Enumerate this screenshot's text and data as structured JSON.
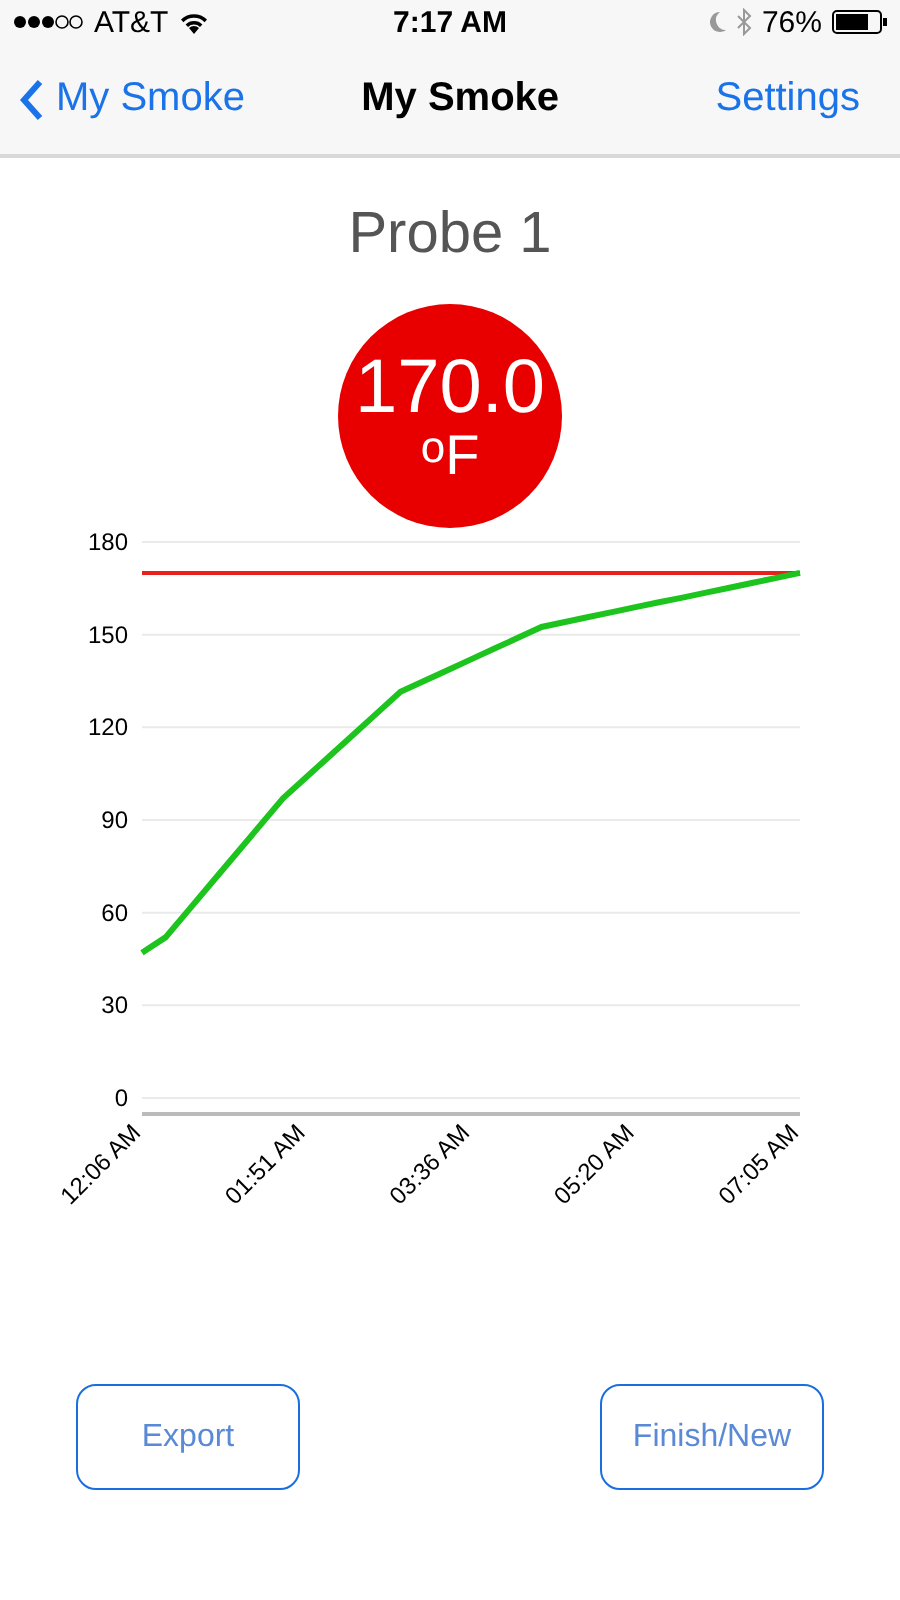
{
  "status_bar": {
    "carrier": "AT&T",
    "time": "7:17 AM",
    "battery_text": "76%"
  },
  "nav": {
    "back": "My Smoke",
    "title": "My Smoke",
    "right": "Settings"
  },
  "probe": {
    "title": "Probe 1",
    "reading": "170.0",
    "unit": "$^{o}$F"
  },
  "chart_data": {
    "type": "line",
    "grid": true,
    "categories": [
      "12:06 AM",
      null,
      null,
      null,
      null,
      null,
      null,
      "01:51 AM",
      null,
      null,
      null,
      null,
      null,
      null,
      "03:36 AM",
      null,
      null,
      null,
      null,
      null,
      null,
      "05:20 AM",
      null,
      null,
      null,
      null,
      null,
      null,
      "07:05 AM"
    ],
    "ylim": [
      0,
      180
    ],
    "yticks": [
      0,
      30,
      60,
      90,
      120,
      150,
      180
    ],
    "series": [
      {
        "color": "#e8201e",
        "values": [
          170,
          170,
          170,
          170,
          170,
          170,
          170,
          170,
          170,
          170,
          170,
          170,
          170,
          170,
          170,
          170,
          170,
          170,
          170,
          170,
          170,
          170,
          170,
          170,
          170,
          170,
          170,
          170,
          170
        ]
      },
      {
        "color": "#1ec41e",
        "values": [
          47,
          52,
          61,
          70,
          79,
          88,
          97,
          103.9,
          110.8,
          117.7,
          124.6,
          131.5,
          135,
          138.5,
          142,
          145.5,
          149,
          152.5,
          154.1,
          155.7,
          157.3,
          158.9,
          160.5,
          162,
          163.6,
          165.2,
          166.8,
          168.4,
          170
        ]
      }
    ]
  },
  "buttons": [
    {
      "label": "Export"
    },
    {
      "label": "Finish/New"
    }
  ]
}
